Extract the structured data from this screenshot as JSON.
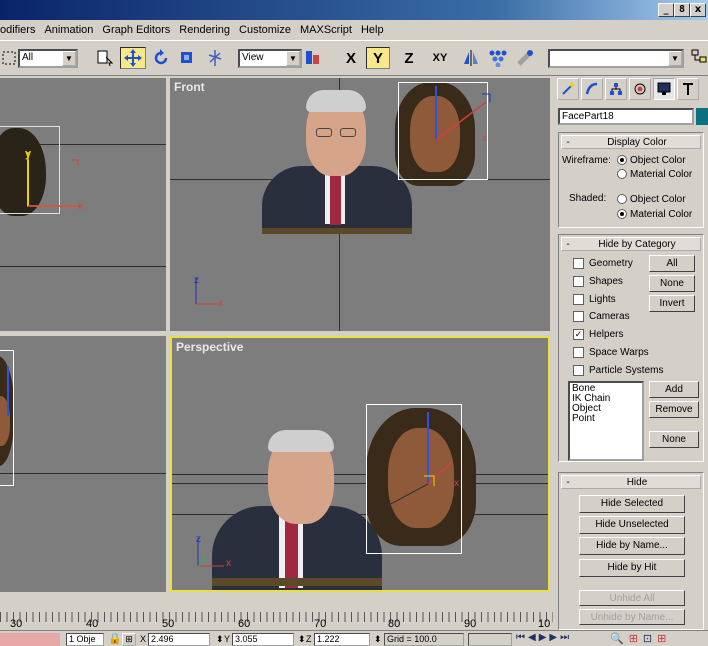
{
  "window": {
    "buttons": [
      "_",
      "8",
      "x"
    ]
  },
  "menu": {
    "items": [
      "odifiers",
      "Animation",
      "Graph Editors",
      "Rendering",
      "Customize",
      "MAXScript",
      "Help"
    ]
  },
  "toolbar": {
    "selection_filter": "All",
    "coord_system": "View",
    "axis_x": "X",
    "axis_y": "Y",
    "axis_z": "Z",
    "axis_xy": "XY",
    "named_selection": ""
  },
  "viewports": {
    "front_label": "Front",
    "perspective_label": "Perspective",
    "axis_x": "x",
    "axis_y": "y",
    "axis_z": "z"
  },
  "panel": {
    "object_name": "FacePart18",
    "display_color": {
      "title": "Display Color",
      "wireframe_label": "Wireframe:",
      "shaded_label": "Shaded:",
      "object_color": "Object Color",
      "material_color": "Material Color",
      "wireframe_selected": "Object Color",
      "shaded_selected": "Material Color"
    },
    "hide_by_category": {
      "title": "Hide by Category",
      "categories": [
        {
          "label": "Geometry",
          "checked": false
        },
        {
          "label": "Shapes",
          "checked": false
        },
        {
          "label": "Lights",
          "checked": false
        },
        {
          "label": "Cameras",
          "checked": false
        },
        {
          "label": "Helpers",
          "checked": true
        },
        {
          "label": "Space Warps",
          "checked": false
        },
        {
          "label": "Particle Systems",
          "checked": false
        }
      ],
      "all_btn": "All",
      "none_btn": "None",
      "invert_btn": "Invert",
      "list": [
        "Bone",
        "IK Chain Object",
        "Point"
      ],
      "add_btn": "Add",
      "remove_btn": "Remove",
      "none2_btn": "None"
    },
    "hide": {
      "title": "Hide",
      "hide_selected": "Hide Selected",
      "hide_unselected": "Hide Unselected",
      "hide_by_name": "Hide by Name...",
      "hide_by_hit": "Hide by Hit",
      "unhide_all": "Unhide All",
      "unhide_by_name": "Unhide by Name..."
    }
  },
  "timeline": {
    "ticks": [
      "30",
      "40",
      "50",
      "60",
      "70",
      "80",
      "90",
      "10"
    ]
  },
  "status": {
    "selection": "1 Obje",
    "x_label": "X",
    "x": "2.496",
    "y_label": "Y",
    "y": "3.055",
    "z_label": "Z",
    "z": "1.222",
    "grid": "Grid = 100.0"
  },
  "colors": {
    "title_bar": "#0a246a",
    "viewport_bg": "#7d7d7d",
    "active_border": "#e8e040",
    "swatch": "#0d7080"
  }
}
